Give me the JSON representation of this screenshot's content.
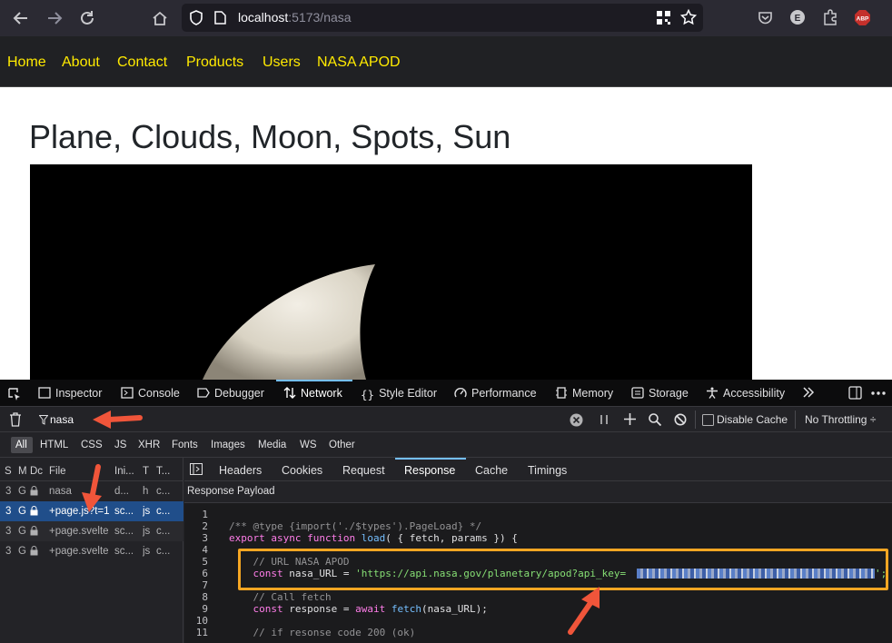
{
  "browser": {
    "url_host": "localhost",
    "url_path": ":5173/nasa"
  },
  "site_nav": {
    "items": [
      "Home",
      "About",
      "Contact",
      "Products",
      "Users",
      "NASA APOD"
    ]
  },
  "page": {
    "title": "Plane, Clouds, Moon, Spots, Sun"
  },
  "devtools": {
    "tabs": [
      "Inspector",
      "Console",
      "Debugger",
      "Network",
      "Style Editor",
      "Performance",
      "Memory",
      "Storage",
      "Accessibility"
    ],
    "active_tab": "Network",
    "filter_value": "nasa",
    "disable_cache_label": "Disable Cache",
    "throttling_label": "No Throttling ÷",
    "type_filters": [
      "All",
      "HTML",
      "CSS",
      "JS",
      "XHR",
      "Fonts",
      "Images",
      "Media",
      "WS",
      "Other"
    ],
    "table_headers": [
      "S",
      "M",
      "Dc",
      "File",
      "Ini...",
      "T",
      "T..."
    ],
    "rows": [
      {
        "status": "3",
        "method": "G",
        "file": "nasa",
        "initiator": "d...",
        "type": "h",
        "transfer": "c..."
      },
      {
        "status": "3",
        "method": "G",
        "file": "+page.js?t=1",
        "initiator": "sc...",
        "type": "js",
        "transfer": "c..."
      },
      {
        "status": "3",
        "method": "G",
        "file": "+page.svelte",
        "initiator": "sc...",
        "type": "js",
        "transfer": "c..."
      },
      {
        "status": "3",
        "method": "G",
        "file": "+page.svelte",
        "initiator": "sc...",
        "type": "js",
        "transfer": "c..."
      }
    ],
    "detail_tabs": [
      "Headers",
      "Cookies",
      "Request",
      "Response",
      "Cache",
      "Timings"
    ],
    "active_detail_tab": "Response",
    "payload_label": "Response Payload",
    "code_lines": [
      {
        "n": "1",
        "text": ""
      },
      {
        "n": "2",
        "text": "/** @type {import('./$types').PageLoad} */"
      },
      {
        "n": "3",
        "kw": "export async function ",
        "fn": "load",
        "rest": "( { fetch, params }) {"
      },
      {
        "n": "4",
        "text": ""
      },
      {
        "n": "5",
        "text": "    // URL NASA APOD"
      },
      {
        "n": "6",
        "kw": "    const ",
        "rest": "nasa_URL = ",
        "str": "'https://api.nasa.gov/planetary/apod?api_key=",
        "tail": "';"
      },
      {
        "n": "7",
        "text": ""
      },
      {
        "n": "8",
        "text": "    // Call fetch"
      },
      {
        "n": "9",
        "kw": "    const ",
        "rest": "response = ",
        "kw2": "await ",
        "fn": "fetch",
        "rest2": "(nasa_URL);"
      },
      {
        "n": "10",
        "text": ""
      },
      {
        "n": "11",
        "text": "    // if resonse code 200 (ok)"
      }
    ]
  },
  "colors": {
    "nav_link": "#ffea00",
    "highlight_box": "#f5a623",
    "annotation_arrow": "#f0553a"
  }
}
